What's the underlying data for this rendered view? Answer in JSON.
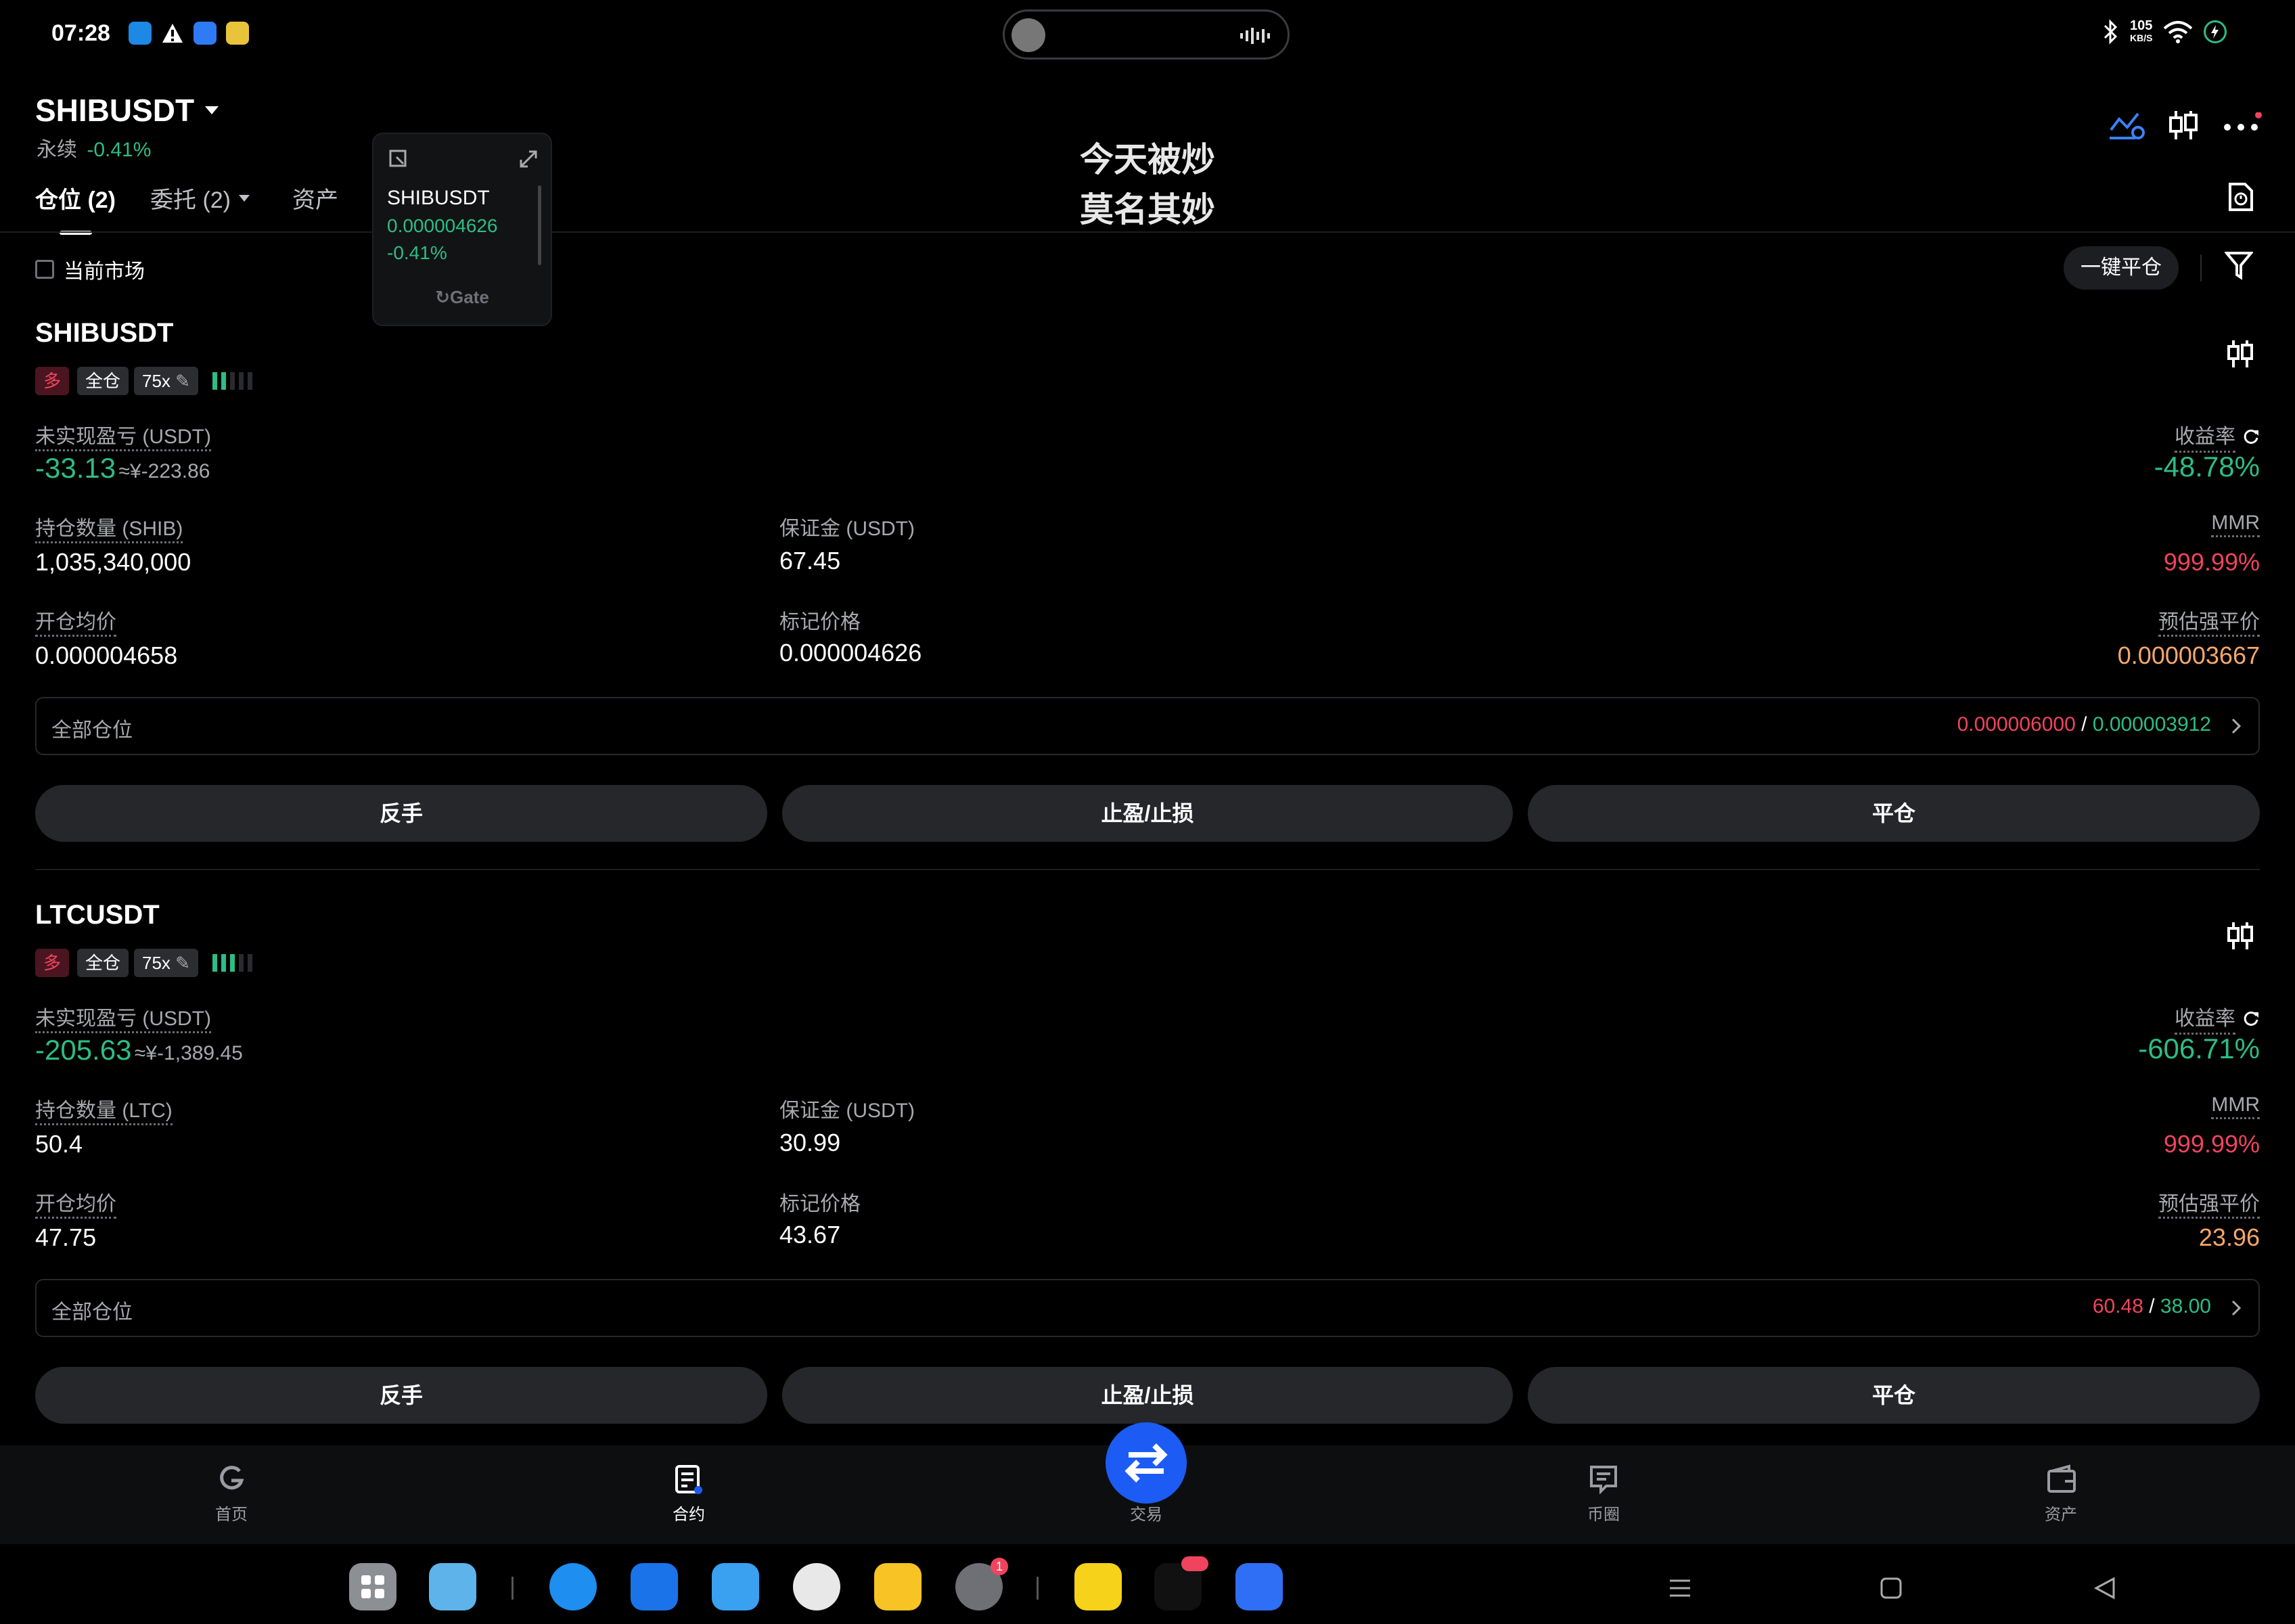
{
  "status_bar": {
    "time": "07:28",
    "net_speed_top": "105",
    "net_speed_bottom": "KB/S"
  },
  "header": {
    "symbol": "SHIBUSDT",
    "contract_type": "永续",
    "change": "-0.41%"
  },
  "tabs": [
    {
      "label": "仓位 (2)"
    },
    {
      "label": "委托 (2)"
    },
    {
      "label": "资产"
    }
  ],
  "overlay_text": {
    "line1": "今天被炒",
    "line2": "莫名其妙"
  },
  "mini_ticker": {
    "symbol": "SHIBUSDT",
    "price": "0.000004626",
    "change": "-0.41%",
    "brand": "Gate"
  },
  "filter": {
    "current_market_label": "当前市场",
    "close_all_label": "一键平仓"
  },
  "positions": [
    {
      "symbol": "SHIBUSDT",
      "side": "多",
      "margin_mode": "全仓",
      "leverage": "75x",
      "pnl_label": "未实现盈亏 (USDT)",
      "pnl": "-33.13",
      "pnl_cny": "≈¥-223.86",
      "roe_label": "收益率",
      "roe": "-48.78%",
      "qty_label": "持仓数量 (SHIB)",
      "qty": "1,035,340,000",
      "margin_label": "保证金 (USDT)",
      "margin": "67.45",
      "mmr_label": "MMR",
      "mmr": "999.99%",
      "entry_label": "开仓均价",
      "entry": "0.000004658",
      "mark_label": "标记价格",
      "mark": "0.000004626",
      "liq_label": "预估强平价",
      "liq": "0.000003667",
      "all_label": "全部仓位",
      "tp": "0.000006000",
      "sl": "0.000003912",
      "sep": "/",
      "btn_reverse": "反手",
      "btn_tpsl": "止盈/止损",
      "btn_close": "平仓"
    },
    {
      "symbol": "LTCUSDT",
      "side": "多",
      "margin_mode": "全仓",
      "leverage": "75x",
      "pnl_label": "未实现盈亏 (USDT)",
      "pnl": "-205.63",
      "pnl_cny": "≈¥-1,389.45",
      "roe_label": "收益率",
      "roe": "-606.71%",
      "qty_label": "持仓数量 (LTC)",
      "qty": "50.4",
      "margin_label": "保证金 (USDT)",
      "margin": "30.99",
      "mmr_label": "MMR",
      "mmr": "999.99%",
      "entry_label": "开仓均价",
      "entry": "47.75",
      "mark_label": "标记价格",
      "mark": "43.67",
      "liq_label": "预估强平价",
      "liq": "23.96",
      "all_label": "全部仓位",
      "tp": "60.48",
      "sl": "38.00",
      "sep": "/",
      "btn_reverse": "反手",
      "btn_tpsl": "止盈/止损",
      "btn_close": "平仓"
    }
  ],
  "bottom_nav": [
    {
      "label": "首页"
    },
    {
      "label": "合约"
    },
    {
      "label": "交易"
    },
    {
      "label": "币圈"
    },
    {
      "label": "资产"
    }
  ],
  "dock": {
    "settings_badge": "1"
  },
  "colors": {
    "green": "#2dbd85",
    "red": "#f0445e",
    "orange": "#f6a86b",
    "accent_blue": "#1c5cf5",
    "bg": "#000000"
  }
}
